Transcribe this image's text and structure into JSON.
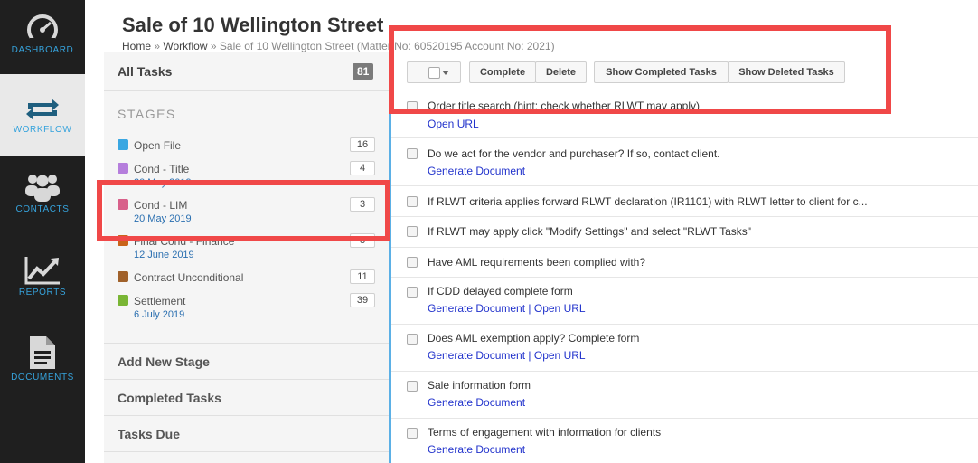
{
  "nav": {
    "dashboard": "DASHBOARD",
    "workflow": "WORKFLOW",
    "contacts": "CONTACTS",
    "reports": "REPORTS",
    "documents": "DOCUMENTS",
    "accent": "#36a3dc"
  },
  "header": {
    "title": "Sale of 10 Wellington Street",
    "breadcrumb": {
      "home": "Home",
      "sep": "»",
      "workflow": "Workflow",
      "current": "Sale of 10 Wellington Street (Matter No: 60520195 Account No: 2021)"
    }
  },
  "panel": {
    "all_tasks": "All Tasks",
    "all_count": "81",
    "stages_heading": "STAGES",
    "stages": [
      {
        "name": "Open File",
        "date": "",
        "count": "16",
        "color": "#3aa7e2"
      },
      {
        "name": "Cond - Title",
        "date": "20 May 2019",
        "count": "4",
        "color": "#b57edc"
      },
      {
        "name": "Cond - LIM",
        "date": "20 May 2019",
        "count": "3",
        "color": "#d8608a"
      },
      {
        "name": "Final Cond - Finance",
        "date": "12 June 2019",
        "count": "8",
        "color": "#c9641a"
      },
      {
        "name": "Contract Unconditional",
        "date": "",
        "count": "11",
        "color": "#a0612a"
      },
      {
        "name": "Settlement",
        "date": "6 July 2019",
        "count": "39",
        "color": "#79b534"
      }
    ],
    "add_stage": "Add New Stage",
    "completed": "Completed Tasks",
    "due": "Tasks Due"
  },
  "toolbar": {
    "complete": "Complete",
    "delete": "Delete",
    "show_completed": "Show Completed Tasks",
    "show_deleted": "Show Deleted Tasks"
  },
  "tasks": [
    {
      "text": "Order title search (hint: check whether RLWT may apply)",
      "links": [
        "Open URL"
      ]
    },
    {
      "text": "Do we act for the vendor and purchaser? If so, contact client.",
      "links": [
        "Generate Document"
      ]
    },
    {
      "text": "If RLWT criteria applies forward RLWT declaration (IR1101) with RLWT letter to client for c...",
      "links": []
    },
    {
      "text": "If RLWT may apply click \"Modify Settings\" and select \"RLWT Tasks\"",
      "links": []
    },
    {
      "text": "Have AML requirements been complied with?",
      "links": []
    },
    {
      "text": "If CDD delayed complete form",
      "links": [
        "Generate Document",
        "Open URL"
      ]
    },
    {
      "text": "Does AML exemption apply? Complete form",
      "links": [
        "Generate Document",
        "Open URL"
      ]
    },
    {
      "text": "Sale information form",
      "links": [
        "Generate Document"
      ]
    },
    {
      "text": "Terms of engagement with information for clients",
      "links": [
        "Generate Document"
      ]
    }
  ],
  "link_sep": "|"
}
